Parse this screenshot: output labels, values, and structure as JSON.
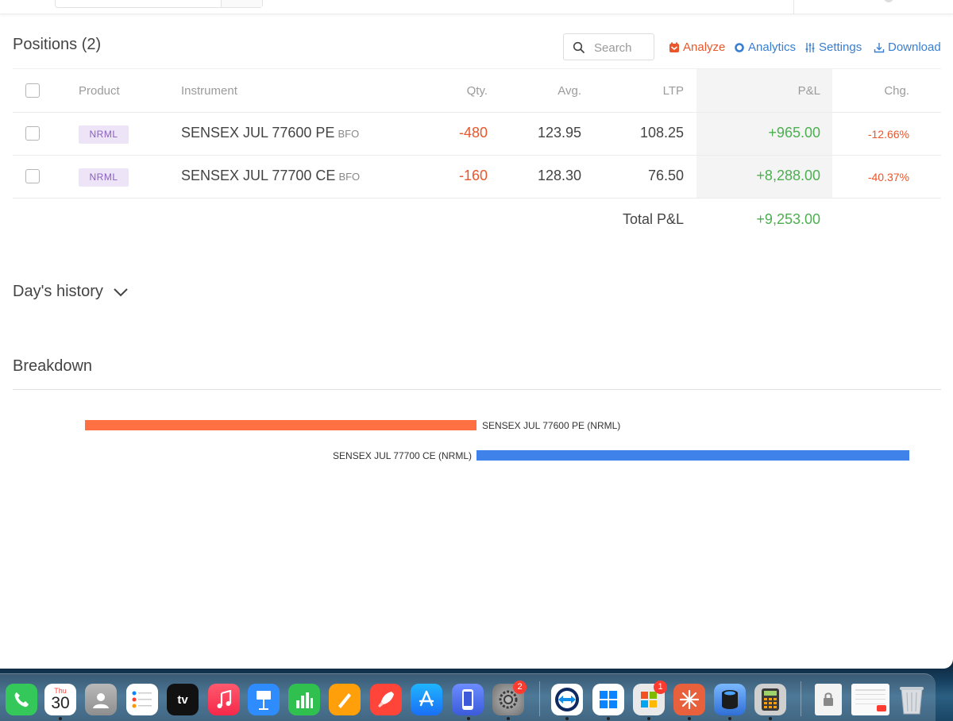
{
  "positions": {
    "title": "Positions (2)",
    "search_placeholder": "Search",
    "actions": {
      "analyze": "Analyze",
      "analytics": "Analytics",
      "settings": "Settings",
      "download": "Download"
    },
    "columns": {
      "product": "Product",
      "instrument": "Instrument",
      "qty": "Qty.",
      "avg": "Avg.",
      "ltp": "LTP",
      "pl": "P&L",
      "chg": "Chg."
    },
    "rows": [
      {
        "product": "NRML",
        "instrument": "SENSEX JUL 77600 PE",
        "exchange": "BFO",
        "qty": "-480",
        "avg": "123.95",
        "ltp": "108.25",
        "pl": "+965.00",
        "chg": "-12.66%"
      },
      {
        "product": "NRML",
        "instrument": "SENSEX JUL 77700 CE",
        "exchange": "BFO",
        "qty": "-160",
        "avg": "128.30",
        "ltp": "76.50",
        "pl": "+8,288.00",
        "chg": "-40.37%"
      }
    ],
    "total_label": "Total P&L",
    "total_value": "+9,253.00"
  },
  "days_history": {
    "label": "Day's history"
  },
  "breakdown": {
    "title": "Breakdown",
    "items": [
      {
        "label": "SENSEX JUL 77600 PE (NRML)",
        "color": "#ff7043",
        "share": 0.475
      },
      {
        "label": "SENSEX JUL 77700 CE (NRML)",
        "color": "#3f83ea",
        "share": 0.525
      }
    ]
  },
  "dock": {
    "calendar_day": "Thu",
    "calendar_date": "30",
    "tv_label": "tv",
    "badges": {
      "system_settings": "2",
      "microsoft": "1"
    },
    "apps": [
      "phone-icon",
      "calendar-icon",
      "contacts-icon",
      "reminders-icon",
      "apple-tv-icon",
      "music-icon",
      "keynote-icon",
      "numbers-icon",
      "pages-icon",
      "rocket-icon",
      "app-store-icon",
      "simulator-icon",
      "system-settings-icon",
      "teamviewer-icon",
      "windows-app-icon",
      "microsoft-apps-icon",
      "claude-icon",
      "backup-icon",
      "calculator-icon",
      "secure-file-icon",
      "calendar-doc-icon",
      "trash-icon"
    ]
  }
}
